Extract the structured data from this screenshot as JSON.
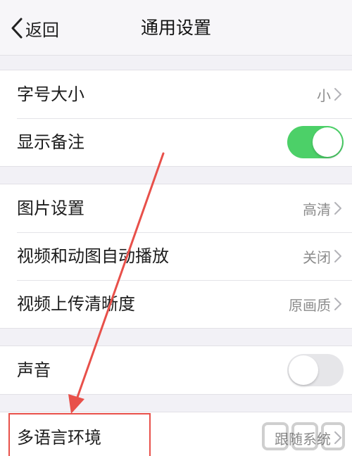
{
  "navbar": {
    "back_label": "返回",
    "title": "通用设置"
  },
  "settings": {
    "font_size": {
      "label": "字号大小",
      "value": "小"
    },
    "show_remark": {
      "label": "显示备注",
      "toggle": "on"
    },
    "image_settings": {
      "label": "图片设置",
      "value": "高清"
    },
    "video_autoplay": {
      "label": "视频和动图自动播放",
      "value": "关闭"
    },
    "video_upload_quality": {
      "label": "视频上传清晰度",
      "value": "原画质"
    },
    "sound": {
      "label": "声音",
      "toggle": "off"
    },
    "language": {
      "label": "多语言环境",
      "value": "跟随系统"
    }
  },
  "colors": {
    "toggle_on": "#4cd068",
    "annotation": "#e8504a"
  }
}
